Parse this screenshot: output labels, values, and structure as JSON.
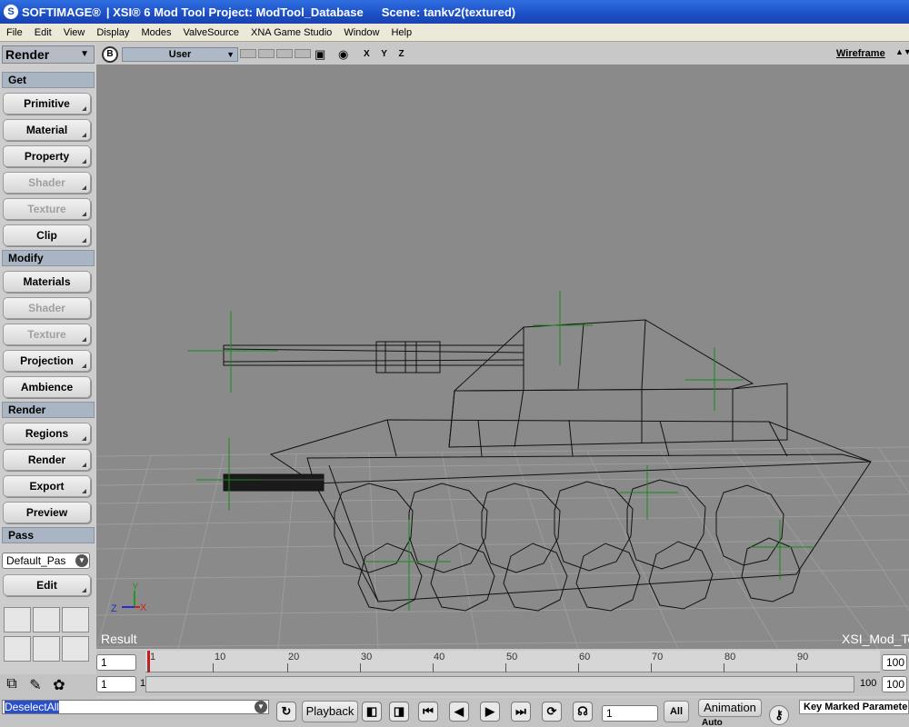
{
  "window": {
    "brand": "SOFTIMAGE®",
    "title": "| XSI® 6 Mod Tool Project: ModTool_Database",
    "scene": "Scene: tankv2(textured)"
  },
  "menu": [
    "File",
    "Edit",
    "View",
    "Display",
    "Modes",
    "ValveSource",
    "XNA Game Studio",
    "Window",
    "Help"
  ],
  "left_panel": {
    "mode": "Render",
    "sections": {
      "get": "Get",
      "modify": "Modify",
      "render": "Render",
      "pass": "Pass"
    },
    "get_buttons": [
      {
        "label": "Primitive",
        "enabled": true
      },
      {
        "label": "Material",
        "enabled": true
      },
      {
        "label": "Property",
        "enabled": true
      },
      {
        "label": "Shader",
        "enabled": false
      },
      {
        "label": "Texture",
        "enabled": false
      },
      {
        "label": "Clip",
        "enabled": true
      }
    ],
    "modify_buttons": [
      {
        "label": "Materials",
        "enabled": true
      },
      {
        "label": "Shader",
        "enabled": false
      },
      {
        "label": "Texture",
        "enabled": false
      },
      {
        "label": "Projection",
        "enabled": true
      },
      {
        "label": "Ambience",
        "enabled": true
      }
    ],
    "render_buttons": [
      {
        "label": "Regions",
        "enabled": true
      },
      {
        "label": "Render",
        "enabled": true
      },
      {
        "label": "Export",
        "enabled": true
      },
      {
        "label": "Preview",
        "enabled": true
      }
    ],
    "pass_value": "Default_Pas",
    "pass_edit": "Edit"
  },
  "viewport": {
    "b_button": "B",
    "camera": "User",
    "axes": "X Y Z",
    "display_mode": "Wireframe",
    "result_label": "Result",
    "watermark": "XSI_Mod_Too",
    "axis_gizmo": {
      "y": "Y",
      "z": "Z",
      "x": "X"
    }
  },
  "timeline": {
    "start_frame": "1",
    "range_start": "1",
    "ruler_labels": [
      "1",
      "10",
      "20",
      "30",
      "40",
      "50",
      "60",
      "70",
      "80",
      "90"
    ],
    "current_frame": 1,
    "range_start_label": "1",
    "range_end_label": "100",
    "end_frame": "100",
    "range_end": "100"
  },
  "bottom": {
    "command": "DeselectAll",
    "playback": "Playback",
    "frame_field": "1",
    "all": "All",
    "animation": "Animation",
    "auto": "Auto",
    "key_label": "Key Marked Parameters"
  },
  "colors": {
    "viewport_bg": "#8a8a8a",
    "title_blue": "#1c4fc7",
    "section_bg": "#a9b5c2",
    "wire": "#111111",
    "centers": "#1a8a1a",
    "grid": "#9c9c9c"
  }
}
